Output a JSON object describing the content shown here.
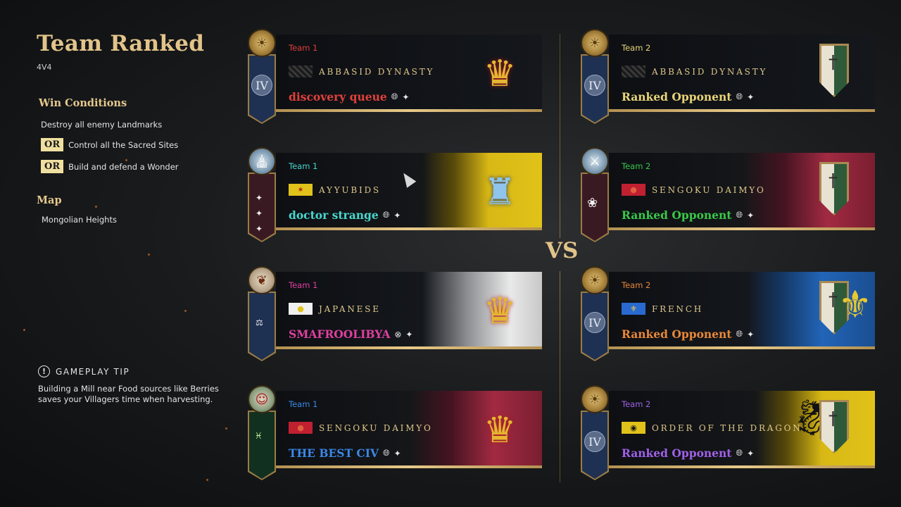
{
  "header": {
    "title": "Team Ranked",
    "mode": "4V4"
  },
  "win_conditions": {
    "heading": "Win Conditions",
    "items": [
      "Destroy all enemy Landmarks",
      "Control all the Sacred Sites",
      "Build and defend a Wonder"
    ],
    "or_label": "OR"
  },
  "map": {
    "heading": "Map",
    "name": "Mongolian Heights"
  },
  "tip": {
    "heading": "GAMEPLAY TIP",
    "text_line1": "Building a Mill near Food sources like Berries",
    "text_line2": "saves your Villagers time when harvesting."
  },
  "vs_label": "VS",
  "team1": [
    {
      "team": "Team 1",
      "civ": "ABBASID DYNASTY",
      "player": "discovery queue",
      "rank": "IV",
      "team_color": "#e0403a",
      "player_color": "#e0403a",
      "bg": "plain",
      "crest": "gold"
    },
    {
      "team": "Team 1",
      "civ": "AYYUBIDS",
      "player": "doctor strange",
      "rank": "",
      "team_color": "#48d8d0",
      "player_color": "#48d8d0",
      "bg": "yellow-flag",
      "crest": "silver"
    },
    {
      "team": "Team 1",
      "civ": "JAPANESE",
      "player": "SMAFROOLIBYA",
      "rank": "",
      "team_color": "#e040a0",
      "player_color": "#e040a0",
      "bg": "white-flag",
      "crest": "gold"
    },
    {
      "team": "Team 1",
      "civ": "SENGOKU DAIMYO",
      "player": "THE BEST CIV",
      "rank": "",
      "team_color": "#3a88e8",
      "player_color": "#3a88e8",
      "bg": "red-flag",
      "crest": "gold"
    }
  ],
  "team2": [
    {
      "team": "Team 2",
      "civ": "ABBASID DYNASTY",
      "player": "Ranked Opponent",
      "rank": "IV",
      "team_color": "#e8d478",
      "player_color": "#e8d478",
      "bg": "plain"
    },
    {
      "team": "Team 2",
      "civ": "SENGOKU DAIMYO",
      "player": "Ranked Opponent",
      "rank": "",
      "team_color": "#38c848",
      "player_color": "#38c848",
      "bg": "red-flag"
    },
    {
      "team": "Team 2",
      "civ": "FRENCH",
      "player": "Ranked Opponent",
      "rank": "IV",
      "team_color": "#e88838",
      "player_color": "#e88838",
      "bg": "blue-flag"
    },
    {
      "team": "Team 2",
      "civ": "ORDER OF THE DRAGON",
      "player": "Ranked Opponent",
      "rank": "IV",
      "team_color": "#a060e8",
      "player_color": "#a060e8",
      "bg": "yellow-flag"
    }
  ],
  "icons": {
    "globe": "globe-icon",
    "platform": "controller-icon",
    "xbox": "xbox-icon",
    "tip": "exclamation-icon"
  }
}
